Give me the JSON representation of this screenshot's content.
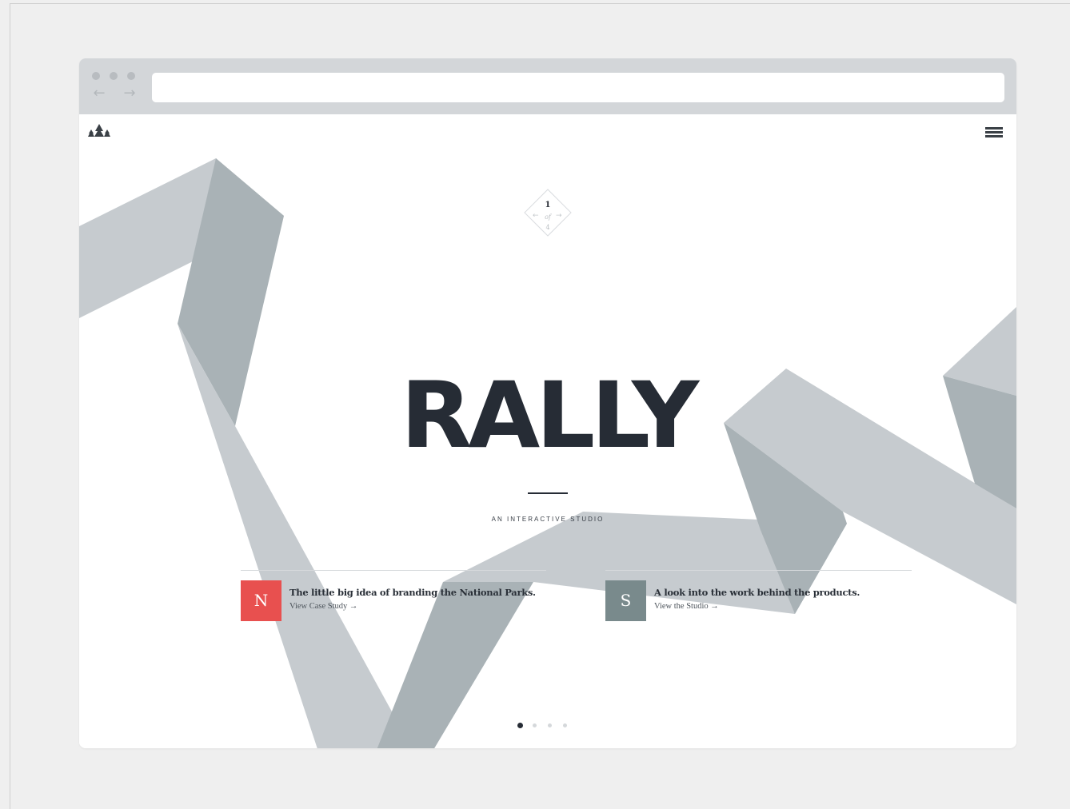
{
  "browser": {
    "back_glyph": "←",
    "forward_glyph": "→",
    "url": ""
  },
  "site": {
    "logo_icon": "pine-trees-icon",
    "menu_icon": "hamburger-menu-icon"
  },
  "slide_counter": {
    "current": "1",
    "of": "of",
    "total": "4",
    "prev_glyph": "←",
    "next_glyph": "→"
  },
  "hero": {
    "title": "RALLY",
    "subtitle": "AN INTERACTIVE STUDIO"
  },
  "features": [
    {
      "badge": "N",
      "badge_color": "#e8504f",
      "headline": "The little big idea of branding the National Parks.",
      "cta": "View Case Study →"
    },
    {
      "badge": "S",
      "badge_color": "#798a8c",
      "headline": "A look into the work behind the products.",
      "cta": "View the Studio →"
    }
  ],
  "pager": {
    "count": 4,
    "active_index": 0,
    "active_color": "#262c35",
    "inactive_color": "#d5d8db"
  },
  "scroll_down": {
    "glyph": "↓"
  },
  "colors": {
    "ribbon_light": "#c6cbcf",
    "ribbon_dark": "#a9b2b6",
    "text_dark": "#262c35"
  }
}
